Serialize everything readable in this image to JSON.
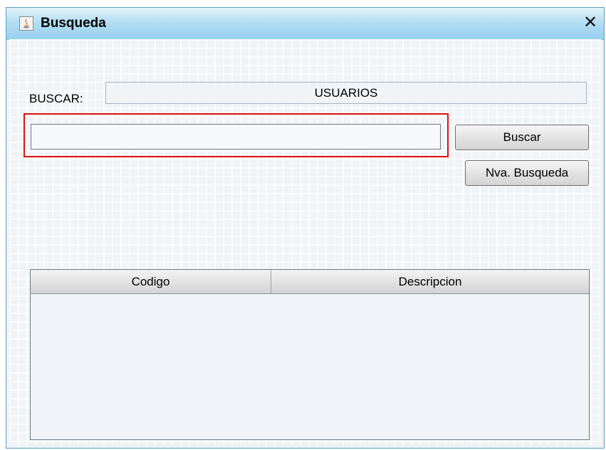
{
  "window": {
    "title": "Busqueda",
    "close_symbol": "✕"
  },
  "form": {
    "buscar_label": "BUSCAR:",
    "category": "USUARIOS",
    "search_value": "",
    "search_placeholder": ""
  },
  "buttons": {
    "buscar": "Buscar",
    "nueva_busqueda": "Nva. Busqueda"
  },
  "table": {
    "columns": [
      "Codigo",
      "Descripcion"
    ],
    "rows": []
  },
  "colors": {
    "titlebar": "#96d0ee",
    "highlight_border": "#e01010",
    "window_background": "#f1f4f7"
  }
}
